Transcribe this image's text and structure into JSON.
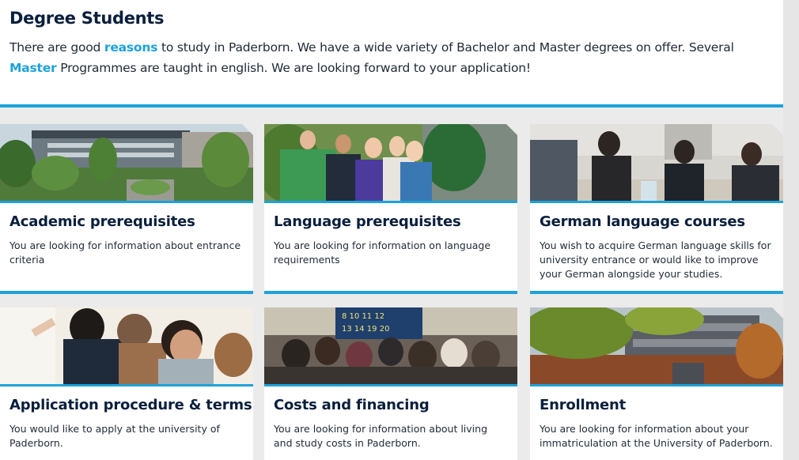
{
  "intro": {
    "title": "Degree Students",
    "text_before": "There are good ",
    "link_reasons": "reasons",
    "text_middle": " to study in Paderborn. We have a wide variety of Bachelor and Master degrees on offer. Several ",
    "link_master": "Master",
    "text_after": " Programmes are taught in english. We are looking forward to your application!"
  },
  "cards": [
    {
      "title": "Academic prerequisites",
      "desc": "You are looking for information about entrance criteria"
    },
    {
      "title": "Language prerequisites",
      "desc": "You are looking for information on language requirements"
    },
    {
      "title": "German language courses",
      "desc": "You wish to acquire German language skills for university entrance or would like to improve your German alongside your studies."
    },
    {
      "title": "Application procedure & terms",
      "desc": "You would like to apply at the university of Paderborn."
    },
    {
      "title": "Costs and financing",
      "desc": "You are looking for information about living and study costs in Paderborn."
    },
    {
      "title": "Enrollment",
      "desc": "You are looking for information about your immatriculation at the University of Paderborn."
    }
  ],
  "colors": {
    "accent": "#1ea2d9",
    "heading": "#0a1f3c",
    "background": "#ebebeb"
  }
}
